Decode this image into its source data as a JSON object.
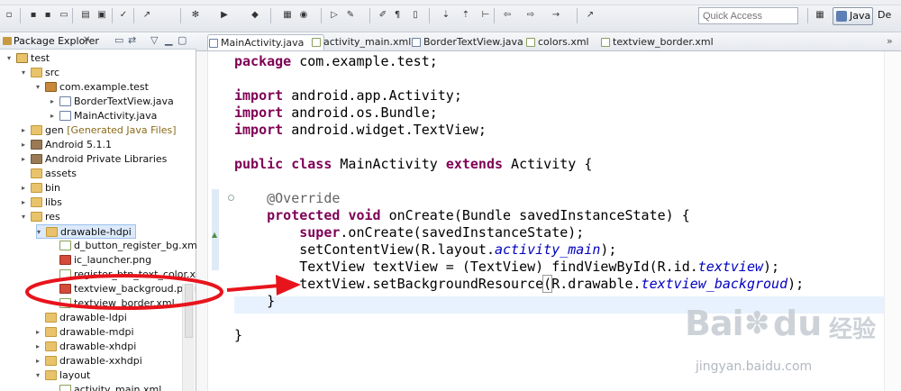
{
  "toolbar": {
    "quick_access_placeholder": "Quick Access",
    "perspective_label": "Java",
    "other_perspective_label": "De"
  },
  "left_panel": {
    "tab_label": "Package Explorer",
    "close_glyph": "✕",
    "tree": [
      {
        "label": "test",
        "icon": "project",
        "arrow": "▾"
      },
      {
        "label": "src",
        "icon": "folder",
        "arrow": "▾"
      },
      {
        "label": "com.example.test",
        "icon": "pkg",
        "arrow": "▾"
      },
      {
        "label": "BorderTextView.java",
        "icon": "java",
        "arrow": "▸"
      },
      {
        "label": "MainActivity.java",
        "icon": "java",
        "arrow": "▸"
      },
      {
        "label": "gen",
        "icon": "folder",
        "arrow": "▸",
        "note": "[Generated Java Files]"
      },
      {
        "label": "Android 5.1.1",
        "icon": "lib",
        "arrow": "▸"
      },
      {
        "label": "Android Private Libraries",
        "icon": "lib",
        "arrow": "▸"
      },
      {
        "label": "assets",
        "icon": "folder",
        "arrow": ""
      },
      {
        "label": "bin",
        "icon": "folder",
        "arrow": "▸"
      },
      {
        "label": "libs",
        "icon": "folder",
        "arrow": "▸"
      },
      {
        "label": "res",
        "icon": "folder",
        "arrow": "▾"
      },
      {
        "label": "drawable-hdpi",
        "icon": "folder",
        "arrow": "▾"
      },
      {
        "label": "d_button_register_bg.xml",
        "icon": "xml",
        "arrow": ""
      },
      {
        "label": "ic_launcher.png",
        "icon": "png",
        "arrow": ""
      },
      {
        "label": "register_btn_text_color.xml",
        "icon": "xml",
        "arrow": ""
      },
      {
        "label": "textview_backgroud.png",
        "icon": "png",
        "arrow": ""
      },
      {
        "label": "textview_border.xml",
        "icon": "xml",
        "arrow": ""
      },
      {
        "label": "drawable-ldpi",
        "icon": "folder",
        "arrow": ""
      },
      {
        "label": "drawable-mdpi",
        "icon": "folder",
        "arrow": "▸"
      },
      {
        "label": "drawable-xhdpi",
        "icon": "folder",
        "arrow": "▸"
      },
      {
        "label": "drawable-xxhdpi",
        "icon": "folder",
        "arrow": "▸"
      },
      {
        "label": "layout",
        "icon": "folder",
        "arrow": "▾"
      },
      {
        "label": "activity_main.xml",
        "icon": "xml",
        "arrow": ""
      }
    ]
  },
  "editor": {
    "tabs": [
      {
        "label": "MainActivity.java",
        "icon": "java",
        "active": true
      },
      {
        "label": "activity_main.xml",
        "icon": "xml",
        "active": false
      },
      {
        "label": "BorderTextView.java",
        "icon": "java",
        "active": false
      },
      {
        "label": "colors.xml",
        "icon": "xml",
        "active": false
      },
      {
        "label": "textview_border.xml",
        "icon": "xml",
        "active": false
      }
    ],
    "tabs_overflow": "»",
    "code_lines": [
      [
        {
          "t": "package",
          "c": "kw"
        },
        {
          "t": " com.example.test;"
        }
      ],
      [],
      [
        {
          "t": "import",
          "c": "kw"
        },
        {
          "t": " android.app.Activity;"
        }
      ],
      [
        {
          "t": "import",
          "c": "kw"
        },
        {
          "t": " android.os.Bundle;"
        }
      ],
      [
        {
          "t": "import",
          "c": "kw"
        },
        {
          "t": " android.widget.TextView;"
        }
      ],
      [],
      [
        {
          "t": "public",
          "c": "kw"
        },
        {
          "t": " "
        },
        {
          "t": "class",
          "c": "kw"
        },
        {
          "t": " MainActivity "
        },
        {
          "t": "extends",
          "c": "kw"
        },
        {
          "t": " Activity {"
        }
      ],
      [],
      [
        {
          "t": "    "
        },
        {
          "t": "@Override",
          "c": "ann"
        }
      ],
      [
        {
          "t": "    "
        },
        {
          "t": "protected",
          "c": "kw"
        },
        {
          "t": " "
        },
        {
          "t": "void",
          "c": "kw"
        },
        {
          "t": " onCreate(Bundle savedInstanceState) {"
        }
      ],
      [
        {
          "t": "        "
        },
        {
          "t": "super",
          "c": "kw"
        },
        {
          "t": ".onCreate(savedInstanceState);"
        }
      ],
      [
        {
          "t": "        setContentView(R.layout."
        },
        {
          "t": "activity_main",
          "c": "fld"
        },
        {
          "t": ");"
        }
      ],
      [
        {
          "t": "        TextView textView = (TextView) findViewById(R.id."
        },
        {
          "t": "textview",
          "c": "fld"
        },
        {
          "t": ");"
        }
      ],
      [
        {
          "t": "        textView.setBackgroundResource"
        },
        {
          "t": "(",
          "c": "paren"
        },
        {
          "t": "R.drawable."
        },
        {
          "t": "textview_backgroud",
          "c": "fld"
        },
        {
          "t": ");"
        }
      ],
      [
        {
          "t": "    }"
        }
      ],
      [],
      [
        {
          "t": "}"
        }
      ]
    ]
  },
  "watermark": {
    "brand": "Bai",
    "brand_cn": "经验",
    "url": "jingyan.baidu.com"
  },
  "colors": {
    "keyword": "#7f0055",
    "field": "#0000c0",
    "annotation_red": "#e8141c",
    "highlight_line": "#e8f2fe"
  }
}
